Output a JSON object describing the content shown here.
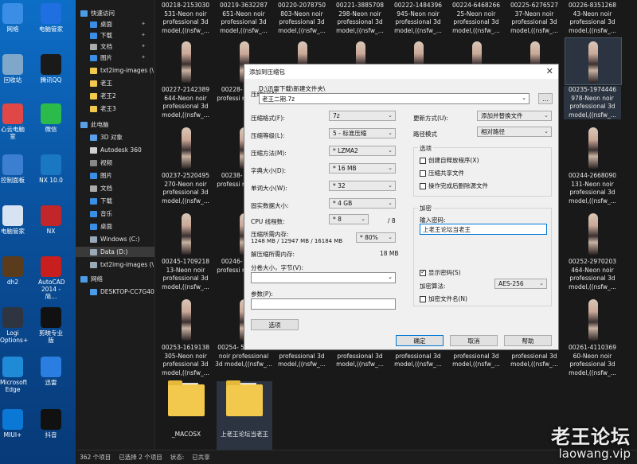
{
  "desktop": {
    "icons": [
      {
        "label": "网络",
        "icon": "network-icon",
        "color": "#3a8ee6"
      },
      {
        "label": "电脑管家",
        "icon": "pc-manager-icon",
        "color": "#1f6fe0"
      },
      {
        "label": "回收站",
        "icon": "recycle-bin-icon",
        "color": "#7fa7c9"
      },
      {
        "label": "腾讯QQ",
        "icon": "qq-icon",
        "color": "#1a1a1a"
      },
      {
        "label": "心云电脑室",
        "icon": "cloud-pc-icon",
        "color": "#e04848"
      },
      {
        "label": "微信",
        "icon": "wechat-icon",
        "color": "#2bbb4a"
      },
      {
        "label": "控制面板",
        "icon": "control-panel-icon",
        "color": "#3c7fd0"
      },
      {
        "label": "NX 10.0",
        "icon": "nx-icon",
        "color": "#1a78c2"
      },
      {
        "label": "电脑管家",
        "icon": "pc-manager-icon",
        "color": "#d7e3f2"
      },
      {
        "label": "NX",
        "icon": "nx-red-icon",
        "color": "#c0262a"
      },
      {
        "label": "dh2",
        "icon": "dh2-icon",
        "color": "#5a3c1c"
      },
      {
        "label": "AutoCAD 2014 - 简...",
        "icon": "autocad-icon",
        "color": "#c81e1e"
      },
      {
        "label": "Logi Options+",
        "icon": "logi-icon",
        "color": "#2e3440"
      },
      {
        "label": "剪映专业版",
        "icon": "capcut-icon",
        "color": "#111111"
      },
      {
        "label": "Microsoft Edge",
        "icon": "edge-icon",
        "color": "#1f8ad6"
      },
      {
        "label": "迅雷",
        "icon": "xunlei-icon",
        "color": "#2a7de1"
      },
      {
        "label": "MIUI+",
        "icon": "miui-icon",
        "color": "#0b78d6"
      },
      {
        "label": "抖音",
        "icon": "douyin-icon",
        "color": "#111111"
      }
    ]
  },
  "nav": {
    "items": [
      {
        "label": "快速访问",
        "icon": "star-icon",
        "color": "#4a9be8"
      },
      {
        "label": "桌面",
        "icon": "desktop-icon",
        "color": "#3a8ee6",
        "pin": true
      },
      {
        "label": "下载",
        "icon": "download-icon",
        "color": "#3a8ee6",
        "pin": true
      },
      {
        "label": "文档",
        "icon": "documents-icon",
        "color": "#aaaaaa",
        "pin": true
      },
      {
        "label": "图片",
        "icon": "pictures-icon",
        "color": "#3a8ee6",
        "pin": true
      },
      {
        "label": "txt2img-images (\\",
        "icon": "folder-icon",
        "color": "#f2c94c"
      },
      {
        "label": "老王",
        "icon": "folder-icon",
        "color": "#f2c94c"
      },
      {
        "label": "老王2",
        "icon": "folder-icon",
        "color": "#f2c94c"
      },
      {
        "label": "老王3",
        "icon": "folder-icon",
        "color": "#f2c94c"
      },
      {
        "label": "此电脑",
        "icon": "this-pc-icon",
        "color": "#5aa0e8"
      },
      {
        "label": "3D 对象",
        "icon": "3d-objects-icon",
        "color": "#5aa0e8"
      },
      {
        "label": "Autodesk 360",
        "icon": "autodesk-icon",
        "color": "#d0d0d0"
      },
      {
        "label": "视频",
        "icon": "videos-icon",
        "color": "#888888"
      },
      {
        "label": "图片",
        "icon": "pictures-icon",
        "color": "#3a8ee6"
      },
      {
        "label": "文档",
        "icon": "documents-icon",
        "color": "#aaaaaa"
      },
      {
        "label": "下载",
        "icon": "download-icon",
        "color": "#3a8ee6"
      },
      {
        "label": "音乐",
        "icon": "music-icon",
        "color": "#3a8ee6"
      },
      {
        "label": "桌面",
        "icon": "desktop-icon",
        "color": "#3a8ee6"
      },
      {
        "label": "Windows (C:)",
        "icon": "drive-icon",
        "color": "#9aa9b8"
      },
      {
        "label": "Data (D:)",
        "icon": "drive-icon",
        "color": "#9aa9b8",
        "selected": true
      },
      {
        "label": "txt2img-images (\\",
        "icon": "network-drive-icon",
        "color": "#9aa9b8"
      },
      {
        "label": "网络",
        "icon": "network-icon",
        "color": "#4a9be8"
      },
      {
        "label": "DESKTOP-CC7G40",
        "icon": "computer-icon",
        "color": "#4a9be8"
      }
    ]
  },
  "files": {
    "row1": [
      {
        "name": "00218-2153030 531-Neon noir professional 3d model,((nsfw_..."
      },
      {
        "name": "00219-3632287 651-Neon noir professional 3d model,((nsfw_..."
      },
      {
        "name": "00220-2078750 803-Neon noir professional 3d model,((nsfw_..."
      },
      {
        "name": "00221-3885708 298-Neon noir professional 3d model,((nsfw_..."
      },
      {
        "name": "00222-1484396 945-Neon noir professional 3d model,((nsfw_..."
      },
      {
        "name": "00224-6468266 25-Neon noir professional 3d model,((nsfw_..."
      },
      {
        "name": "00225-6276527 37-Neon noir professional 3d model,((nsfw_..."
      },
      {
        "name": "00226-8351268 43-Neon noir professional 3d model,((nsfw_..."
      }
    ],
    "row2": [
      {
        "name": "00227-2142389 644-Neon noir professional 3d model,((nsfw_..."
      },
      {
        "name": "00228- 927-Ne professi model,(..."
      },
      {
        "name": "00235-1974446 978-Neon noir professional 3d model,((nsfw_...",
        "selected": true
      }
    ],
    "row3": [
      {
        "name": "00237-2520495 270-Neon noir professional 3d model,((nsfw_..."
      },
      {
        "name": "00238- 676-Ne professi model,(..."
      },
      {
        "name": "00244-2668090 131-Neon noir professional 3d model,((nsfw_..."
      }
    ],
    "row4": [
      {
        "name": "00245-1709218 13-Neon noir professional 3d model,((nsfw_..."
      },
      {
        "name": "00246- 928-Ne professi model,(..."
      },
      {
        "name": "00252-2970203 464-Neon noir professional 3d model,((nsfw_..."
      }
    ],
    "row5": [
      {
        "name": "00253-1619138 305-Neon noir professional 3d model,((nsfw_..."
      },
      {
        "name": "00254- 506-Neon noir professional 3d model,((nsfw_..."
      },
      {
        "name": "259-Neon noir professional 3d model,((nsfw_..."
      },
      {
        "name": "586-Neon noir professional 3d model,((nsfw_..."
      },
      {
        "name": "488-Neon noir professional 3d model,((nsfw_..."
      },
      {
        "name": "788-Neon noir professional 3d model,((nsfw_..."
      },
      {
        "name": "178-Neon noir professional 3d model,((nsfw_..."
      },
      {
        "name": "00261-4110369 60-Neon noir professional 3d model,((nsfw_..."
      }
    ],
    "folders": [
      {
        "name": "_MACOSX"
      },
      {
        "name": "上老王论坛当老王",
        "selected": true
      }
    ]
  },
  "status": {
    "count": "362 个项目",
    "selected": "已选择 2 个项目",
    "state_label": "状态:",
    "shared": "已共享"
  },
  "dialog": {
    "title": "添加到压缩包",
    "close": "✕",
    "archive_label": "压缩包(A):",
    "archive_path": "D:\\迅雷下载\\新建文件夹\\",
    "archive_name": "老王二期.7z",
    "browse": "...",
    "format_label": "压缩格式(F):",
    "format_value": "7z",
    "level_label": "压缩等级(L):",
    "level_value": "5 - 标准压缩",
    "method_label": "压缩方法(M):",
    "method_value": "* LZMA2",
    "dict_label": "字典大小(D):",
    "dict_value": "* 16 MB",
    "word_label": "单词大小(W):",
    "word_value": "* 32",
    "solid_label": "固实数据大小:",
    "solid_value": "* 4 GB",
    "threads_label": "CPU 线程数:",
    "threads_value": "* 8",
    "threads_total": "/ 8",
    "mem_label": "压缩所需内存:",
    "mem_detail": "1248 MB / 12947 MB / 16184 MB",
    "mem_value": "* 80%",
    "demem_label": "解压缩所需内存:",
    "demem_value": "18 MB",
    "split_label": "分卷大小，字节(V):",
    "params_label": "参数(P):",
    "options_btn": "选项",
    "update_label": "更新方式(U):",
    "update_value": "添加并替换文件",
    "pathmode_label": "路径模式",
    "pathmode_value": "相对路径",
    "options_group": "选项",
    "opt_sfx": "创建自释放程序(X)",
    "opt_shared": "压缩共享文件",
    "opt_delete": "操作完成后删除源文件",
    "encrypt_group": "加密",
    "password_label": "输入密码:",
    "password_value": "上老王论坛当老王",
    "show_password": "显示密码(S)",
    "enc_method_label": "加密算法:",
    "enc_method_value": "AES-256",
    "enc_names": "加密文件名(N)",
    "ok": "确定",
    "cancel": "取消",
    "help": "帮助"
  },
  "watermark": {
    "title": "老王论坛",
    "url": "laowang.vip"
  }
}
